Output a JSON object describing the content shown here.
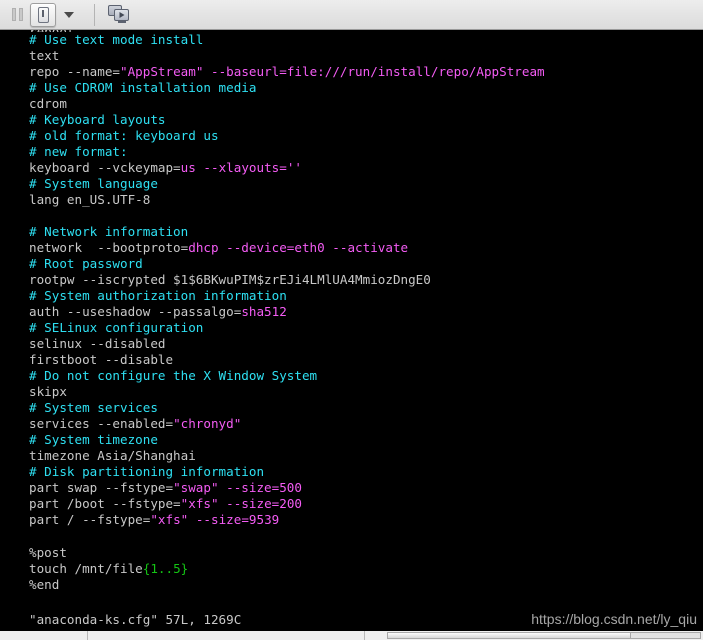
{
  "toolbar": {
    "pause_label": "Pause",
    "power_label": "Send key / Power",
    "dropdown_label": "More actions",
    "display_label": "Display / Console view",
    "icons": {
      "pause": "pause-icon",
      "power": "power-icon",
      "caret": "chevron-down-icon",
      "display": "display-icon"
    }
  },
  "terminal": {
    "clipped_top_line": "reboot",
    "lines": [
      {
        "type": "comment",
        "text": "# Use text mode install"
      },
      {
        "type": "plain",
        "text": "text"
      },
      {
        "type": "mixed",
        "parts": [
          {
            "c": "pln",
            "t": "repo --name="
          },
          {
            "c": "str",
            "t": "\"AppStream\""
          },
          {
            "c": "pln",
            "t": " "
          },
          {
            "c": "opt",
            "t": "--baseurl=file:///run/install/repo/AppStream"
          }
        ]
      },
      {
        "type": "comment",
        "text": "# Use CDROM installation media"
      },
      {
        "type": "plain",
        "text": "cdrom"
      },
      {
        "type": "comment",
        "text": "# Keyboard layouts"
      },
      {
        "type": "comment",
        "text": "# old format: keyboard us"
      },
      {
        "type": "comment",
        "text": "# new format:"
      },
      {
        "type": "mixed",
        "parts": [
          {
            "c": "pln",
            "t": "keyboard --vckeymap="
          },
          {
            "c": "opt",
            "t": "us"
          },
          {
            "c": "opt",
            "t": " --xlayouts="
          },
          {
            "c": "str",
            "t": "''"
          }
        ]
      },
      {
        "type": "comment",
        "text": "# System language"
      },
      {
        "type": "plain",
        "text": "lang en_US.UTF-8"
      },
      {
        "type": "blank",
        "text": ""
      },
      {
        "type": "comment",
        "text": "# Network information"
      },
      {
        "type": "mixed",
        "parts": [
          {
            "c": "pln",
            "t": "network  --bootproto="
          },
          {
            "c": "opt",
            "t": "dhcp --device=eth0 --activate"
          }
        ]
      },
      {
        "type": "comment",
        "text": "# Root password"
      },
      {
        "type": "plain",
        "text": "rootpw --iscrypted $1$6BKwuPIM$zrEJi4LMlUA4MmiozDngE0"
      },
      {
        "type": "comment",
        "text": "# System authorization information"
      },
      {
        "type": "mixed",
        "parts": [
          {
            "c": "pln",
            "t": "auth --useshadow --passalgo="
          },
          {
            "c": "opt",
            "t": "sha512"
          }
        ]
      },
      {
        "type": "comment",
        "text": "# SELinux configuration"
      },
      {
        "type": "plain",
        "text": "selinux --disabled"
      },
      {
        "type": "plain",
        "text": "firstboot --disable"
      },
      {
        "type": "comment",
        "text": "# Do not configure the X Window System"
      },
      {
        "type": "plain",
        "text": "skipx"
      },
      {
        "type": "comment",
        "text": "# System services"
      },
      {
        "type": "mixed",
        "parts": [
          {
            "c": "pln",
            "t": "services --enabled="
          },
          {
            "c": "str",
            "t": "\"chronyd\""
          }
        ]
      },
      {
        "type": "comment",
        "text": "# System timezone"
      },
      {
        "type": "plain",
        "text": "timezone Asia/Shanghai"
      },
      {
        "type": "comment",
        "text": "# Disk partitioning information"
      },
      {
        "type": "mixed",
        "parts": [
          {
            "c": "pln",
            "t": "part swap --fstype="
          },
          {
            "c": "str",
            "t": "\"swap\""
          },
          {
            "c": "opt",
            "t": " --size=500"
          }
        ]
      },
      {
        "type": "mixed",
        "parts": [
          {
            "c": "pln",
            "t": "part /boot --fstype="
          },
          {
            "c": "str",
            "t": "\"xfs\""
          },
          {
            "c": "opt",
            "t": " --size=200"
          }
        ]
      },
      {
        "type": "mixed",
        "parts": [
          {
            "c": "pln",
            "t": "part / --fstype="
          },
          {
            "c": "str",
            "t": "\"xfs\""
          },
          {
            "c": "opt",
            "t": " --size=9539"
          }
        ]
      },
      {
        "type": "blank",
        "text": ""
      },
      {
        "type": "plain",
        "text": "%post"
      },
      {
        "type": "mixed",
        "parts": [
          {
            "c": "pln",
            "t": "touch /mnt/file"
          },
          {
            "c": "grn",
            "t": "{1..5}"
          }
        ]
      },
      {
        "type": "plain",
        "text": "%end"
      }
    ],
    "status_line": "\"anaconda-ks.cfg\" 57L, 1269C",
    "watermark": "https://blog.csdn.net/ly_qiu"
  },
  "colors": {
    "background": "#000000",
    "foreground": "#c8c8c8",
    "comment": "#2ee0f2",
    "string": "#f45cf4",
    "option": "#f45cf4",
    "special": "#14c414",
    "toolbar_bg": "#e4e4e4"
  }
}
